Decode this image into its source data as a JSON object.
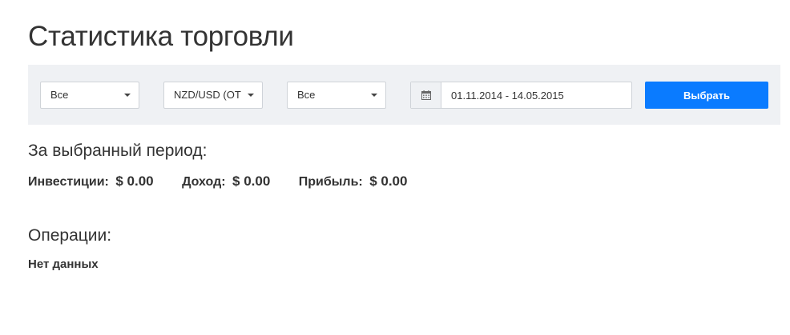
{
  "page": {
    "title": "Статистика торговли"
  },
  "filters": {
    "select1": {
      "value": "Все"
    },
    "select2": {
      "value": "NZD/USD (OTC)"
    },
    "select3": {
      "value": "Все"
    },
    "date_range": {
      "value": "01.11.2014 - 14.05.2015",
      "icon": "calendar-icon"
    },
    "submit_label": "Выбрать"
  },
  "period": {
    "title": "За выбранный период:",
    "stats": [
      {
        "label": "Инвестиции:",
        "value": "$ 0.00"
      },
      {
        "label": "Доход:",
        "value": "$ 0.00"
      },
      {
        "label": "Прибыль:",
        "value": "$ 0.00"
      }
    ]
  },
  "operations": {
    "title": "Операции:",
    "empty_text": "Нет данных"
  },
  "colors": {
    "accent": "#0a7bff",
    "filter_background": "#eff1f4",
    "text": "#333333"
  }
}
